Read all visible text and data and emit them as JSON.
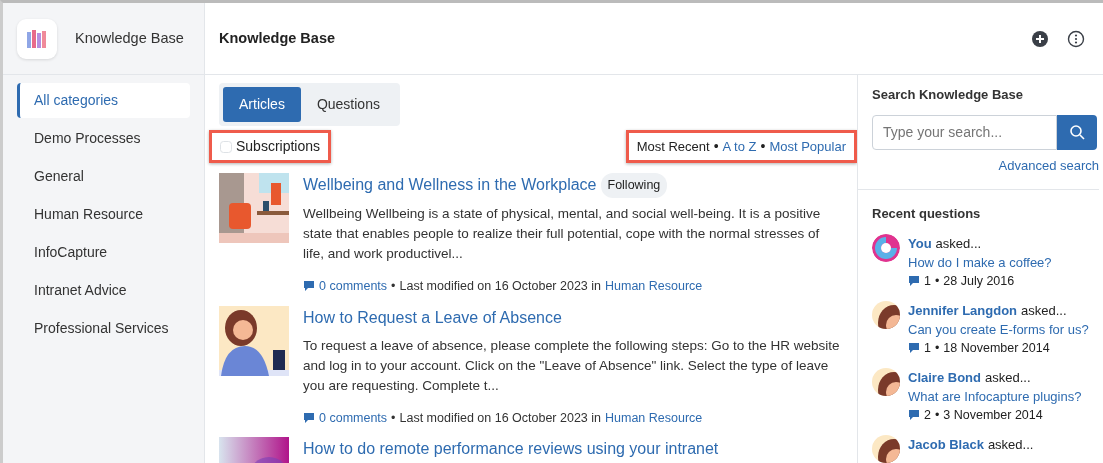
{
  "app": {
    "name": "Knowledge Base"
  },
  "header": {
    "title": "Knowledge Base"
  },
  "sidebar": {
    "items": [
      {
        "label": "All categories",
        "selected": true
      },
      {
        "label": "Demo Processes",
        "selected": false
      },
      {
        "label": "General",
        "selected": false
      },
      {
        "label": "Human Resource",
        "selected": false
      },
      {
        "label": "InfoCapture",
        "selected": false
      },
      {
        "label": "Intranet Advice",
        "selected": false
      },
      {
        "label": "Professional Services",
        "selected": false
      }
    ]
  },
  "tabs": [
    {
      "label": "Articles",
      "selected": true
    },
    {
      "label": "Questions",
      "selected": false
    }
  ],
  "subscriptions": {
    "label": "Subscriptions",
    "checked": false,
    "highlighted": true
  },
  "sort": {
    "highlighted": true,
    "separator": "•",
    "options": [
      {
        "label": "Most Recent",
        "selected": true
      },
      {
        "label": "A to Z",
        "selected": false
      },
      {
        "label": "Most Popular",
        "selected": false
      }
    ]
  },
  "articles": [
    {
      "title": "Wellbeing and Wellness in the Workplace",
      "badge": "Following",
      "excerpt": "Wellbeing Wellbeing is a state of physical, mental, and social well-being. It is a positive state that enables people to realize their full potential, cope with the normal stresses of life, and work productivel...",
      "comments": "0 comments",
      "separator": "•",
      "modified": "Last modified on 16 October 2023 in",
      "category": "Human Resource"
    },
    {
      "title": "How to Request a Leave of Absence",
      "excerpt": "To request a leave of absence, please complete the following steps: Go to the HR website and log in to your account. Click on the \"Leave of Absence\" link. Select the type of leave you are requesting. Complete t...",
      "comments": "0 comments",
      "separator": "•",
      "modified": "Last modified on 16 October 2023 in",
      "category": "Human Resource"
    },
    {
      "title": "How to do remote performance reviews using your intranet"
    }
  ],
  "search": {
    "title": "Search Knowledge Base",
    "placeholder": "Type your search...",
    "advanced": "Advanced search"
  },
  "recent": {
    "title": "Recent questions",
    "items": [
      {
        "author": "You",
        "asked": "asked...",
        "question": "How do I make a coffee?",
        "count": "1",
        "separator": "•",
        "date": "28 July 2016"
      },
      {
        "author": "Jennifer Langdon",
        "asked": "asked...",
        "question": "Can you create E-forms for us?",
        "count": "1",
        "separator": "•",
        "date": "18 November 2014"
      },
      {
        "author": "Claire Bond",
        "asked": "asked...",
        "question": "What are Infocapture plugins?",
        "count": "2",
        "separator": "•",
        "date": "3 November 2014"
      },
      {
        "author": "Jacob Black",
        "asked": "asked..."
      }
    ]
  }
}
